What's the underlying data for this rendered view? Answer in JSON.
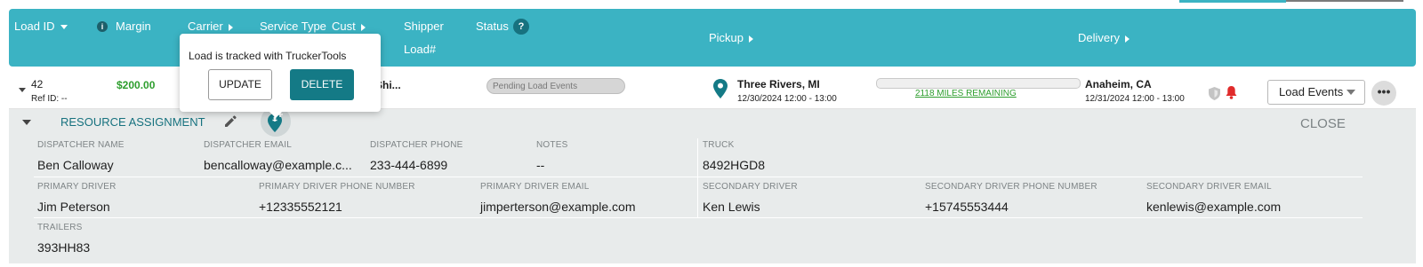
{
  "header": {
    "load_id": "Load ID",
    "margin": "Margin",
    "carrier": "Carrier",
    "service_type": "Service Type",
    "cust": "Cust",
    "shipper": "Shipper",
    "load_num": "Load#",
    "status": "Status",
    "status_help": "?",
    "info_icon": "i",
    "pickup": "Pickup",
    "delivery": "Delivery"
  },
  "load": {
    "id": "42",
    "ref_id": "Ref ID: --",
    "margin": "$200.00",
    "shipper": "Shi...",
    "status": "Pending Load Events",
    "pickup_city": "Three Rivers, MI",
    "pickup_time": "12/30/2024 12:00 - 13:00",
    "miles_remaining": "2118 MILES REMAINING",
    "progress": 0,
    "delivery_city": "Anaheim, CA",
    "delivery_time": "12/31/2024 12:00 - 13:00",
    "load_events_select": "Load Events",
    "more": "•••"
  },
  "popover": {
    "message": "Load is tracked with TruckerTools",
    "update": "UPDATE",
    "delete": "DELETE"
  },
  "resource": {
    "title": "RESOURCE ASSIGNMENT",
    "close": "CLOSE",
    "dispatcher_name_label": "DISPATCHER NAME",
    "dispatcher_name": "Ben Calloway",
    "dispatcher_email_label": "DISPATCHER EMAIL",
    "dispatcher_email": "bencalloway@example.c...",
    "dispatcher_phone_label": "DISPATCHER PHONE",
    "dispatcher_phone": "233-444-6899",
    "notes_label": "NOTES",
    "notes": "--",
    "truck_label": "TRUCK",
    "truck": "8492HGD8",
    "primary_driver_label": "PRIMARY DRIVER",
    "primary_driver": "Jim Peterson",
    "primary_phone_label": "PRIMARY DRIVER PHONE NUMBER",
    "primary_phone": "+12335552121",
    "primary_email_label": "PRIMARY DRIVER EMAIL",
    "primary_email": "jimperterson@example.com",
    "secondary_driver_label": "SECONDARY DRIVER",
    "secondary_driver": "Ken Lewis",
    "secondary_phone_label": "SECONDARY DRIVER PHONE NUMBER",
    "secondary_phone": "+15745553444",
    "secondary_email_label": "SECONDARY DRIVER EMAIL",
    "secondary_email": "kenlewis@example.com",
    "trailers_label": "TRAILERS",
    "trailers": "393HH83"
  },
  "colors": {
    "header": "#3bb3c3",
    "accent": "#147a86",
    "margin_green": "#2e9e2e",
    "alert_red": "#e02b2b"
  },
  "icons": [
    "info-icon",
    "help-icon",
    "map-pin-icon",
    "shield-icon",
    "bell-icon",
    "pencil-icon",
    "location-add-icon",
    "chevron-down-icon",
    "more-icon"
  ]
}
